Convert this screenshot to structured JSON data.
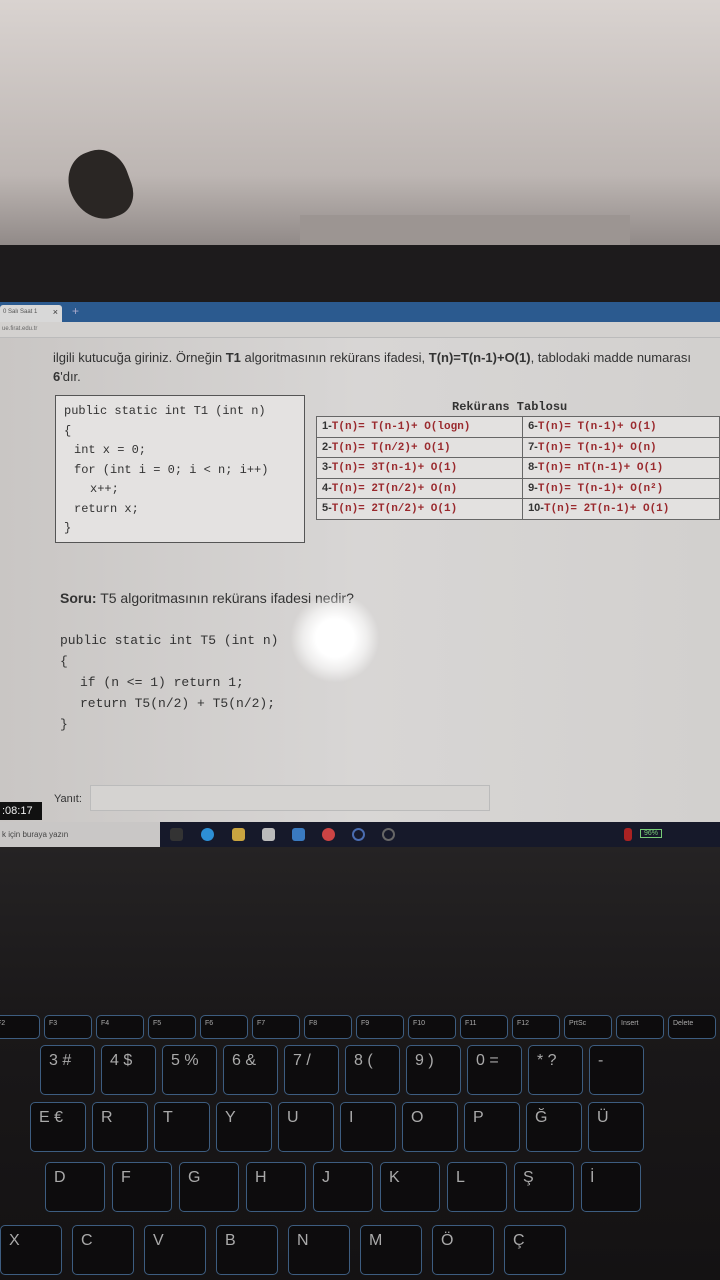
{
  "browser": {
    "tab_label": "0 Salı Saat 1",
    "close": "×",
    "new_tab": "+",
    "url": "ue.firat.edu.tr"
  },
  "question": {
    "intro_pre": "ilgili kutucuğa giriniz. Örneğin ",
    "intro_t1": "T1",
    "intro_mid": " algoritmasının rekürans ifadesi, ",
    "intro_expr": "T(n)=T(n-1)+O(1)",
    "intro_post": ", tablodaki madde numarası ",
    "intro_num": "6",
    "intro_end": "'dır.",
    "example_code": [
      "public static int T1 (int n)",
      "{",
      "int x = 0;",
      "for (int i = 0; i < n; i++)",
      "x++;",
      "return x;",
      "}"
    ],
    "table_title": "Rekürans Tablosu",
    "table": [
      [
        {
          "n": "1-",
          "f": "T(n)= T(n-1)+ O(logn)"
        },
        {
          "n": "6-",
          "f": "T(n)= T(n-1)+ O(1)"
        }
      ],
      [
        {
          "n": "2-",
          "f": "T(n)= T(n/2)+ O(1)"
        },
        {
          "n": "7-",
          "f": "T(n)= T(n-1)+ O(n)"
        }
      ],
      [
        {
          "n": "3-",
          "f": "T(n)= 3T(n-1)+ O(1)"
        },
        {
          "n": "8-",
          "f": "T(n)= nT(n-1)+ O(1)"
        }
      ],
      [
        {
          "n": "4-",
          "f": "T(n)= 2T(n/2)+ O(n)"
        },
        {
          "n": "9-",
          "f": "T(n)= T(n-1)+ O(n²)"
        }
      ],
      [
        {
          "n": "5-",
          "f": "T(n)= 2T(n/2)+ O(1)"
        },
        {
          "n": "10-",
          "f": "T(n)= 2T(n-1)+ O(1)"
        }
      ]
    ],
    "soru_label": "Soru:",
    "soru_text": " T5 algoritmasının rekürans ifadesi nedir?",
    "code": [
      "public static int T5 (int n)",
      "{",
      "if (n <= 1) return 1;",
      "return T5(n/2) + T5(n/2);",
      "}"
    ],
    "answer_label": "Yanıt:",
    "answer_value": ""
  },
  "timer": ":08:17",
  "taskbar": {
    "search_placeholder": "k için buraya yazın",
    "battery": "96%"
  },
  "keyboard": {
    "fkeys": [
      "F2",
      "F3",
      "F4",
      "F5",
      "F6",
      "F7",
      "F8",
      "F9",
      "F10",
      "F11",
      "F12",
      "PrtSc",
      "Insert",
      "Delete"
    ],
    "row1": [
      "3 #",
      "4 $",
      "5 %",
      "6 &",
      "7 /",
      "8 (",
      "9 )",
      "0 =",
      "* ?",
      "-"
    ],
    "row2": [
      "E €",
      "R",
      "T",
      "Y",
      "U",
      "I",
      "O",
      "P",
      "Ğ",
      "Ü"
    ],
    "row3": [
      "D",
      "F",
      "G",
      "H",
      "J",
      "K",
      "L",
      "Ş",
      "İ"
    ],
    "row4": [
      "X",
      "C",
      "V",
      "B",
      "N",
      "M",
      "Ö",
      "Ç"
    ]
  }
}
